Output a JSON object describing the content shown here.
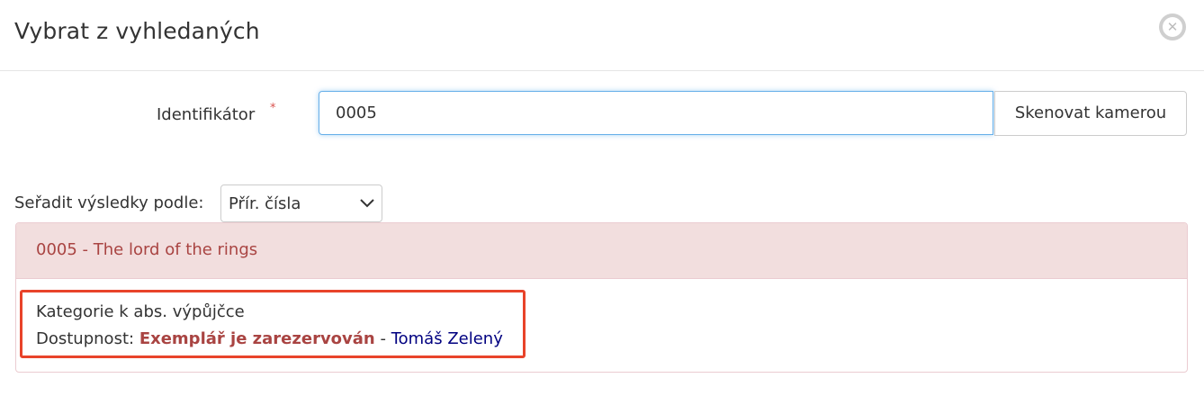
{
  "modal": {
    "title": "Vybrat z vyhledaných",
    "close_icon": "close-circle-icon"
  },
  "form": {
    "identifier_label": "Identifikátor",
    "required_mark": "*",
    "identifier_value": "0005",
    "scan_button": "Skenovat kamerou"
  },
  "sort": {
    "label": "Seřadit výsledky podle:",
    "selected": "Přír. čísla"
  },
  "result": {
    "title": "0005 - The lord of the rings",
    "category": "Kategorie k abs. výpůjčce",
    "availability_label": "Dostupnost:",
    "status": "Exemplář je zarezervován",
    "separator": " - ",
    "reserved_by": "Tomáš Zelený"
  },
  "colors": {
    "danger_text": "#a94442",
    "danger_bg": "#f2dede",
    "highlight_border": "#e8432a",
    "link": "#000080",
    "focus_border": "#66afe9"
  }
}
